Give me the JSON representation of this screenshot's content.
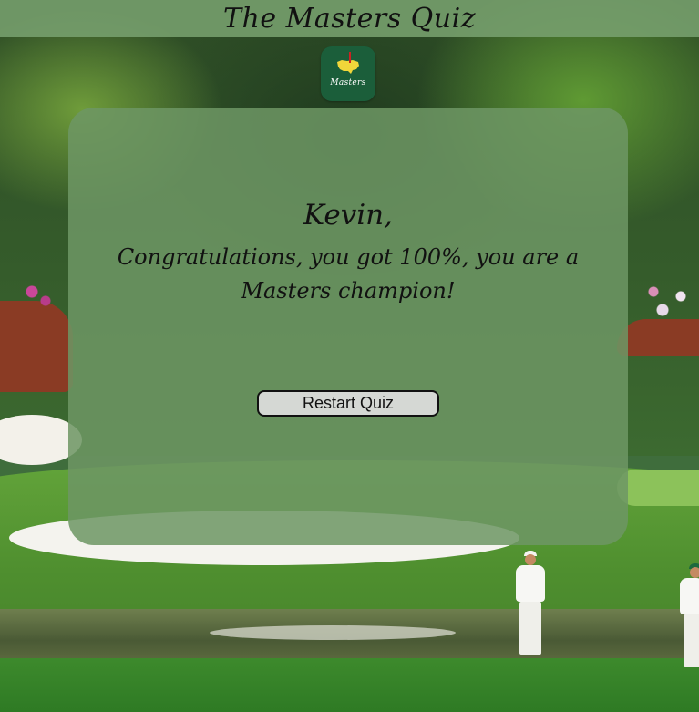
{
  "header": {
    "title": "The Masters Quiz"
  },
  "logo": {
    "text": "Masters",
    "icon": "masters-logo-icon"
  },
  "result": {
    "player_name": "Kevin,",
    "message": "Congratulations, you got 100%, you are a Masters champion!"
  },
  "actions": {
    "restart_label": "Restart Quiz"
  },
  "colors": {
    "header_bg": "#78a06e",
    "card_bg": "#6e9664",
    "logo_bg": "#1b5e3a",
    "button_bg": "#d5d8d4"
  }
}
